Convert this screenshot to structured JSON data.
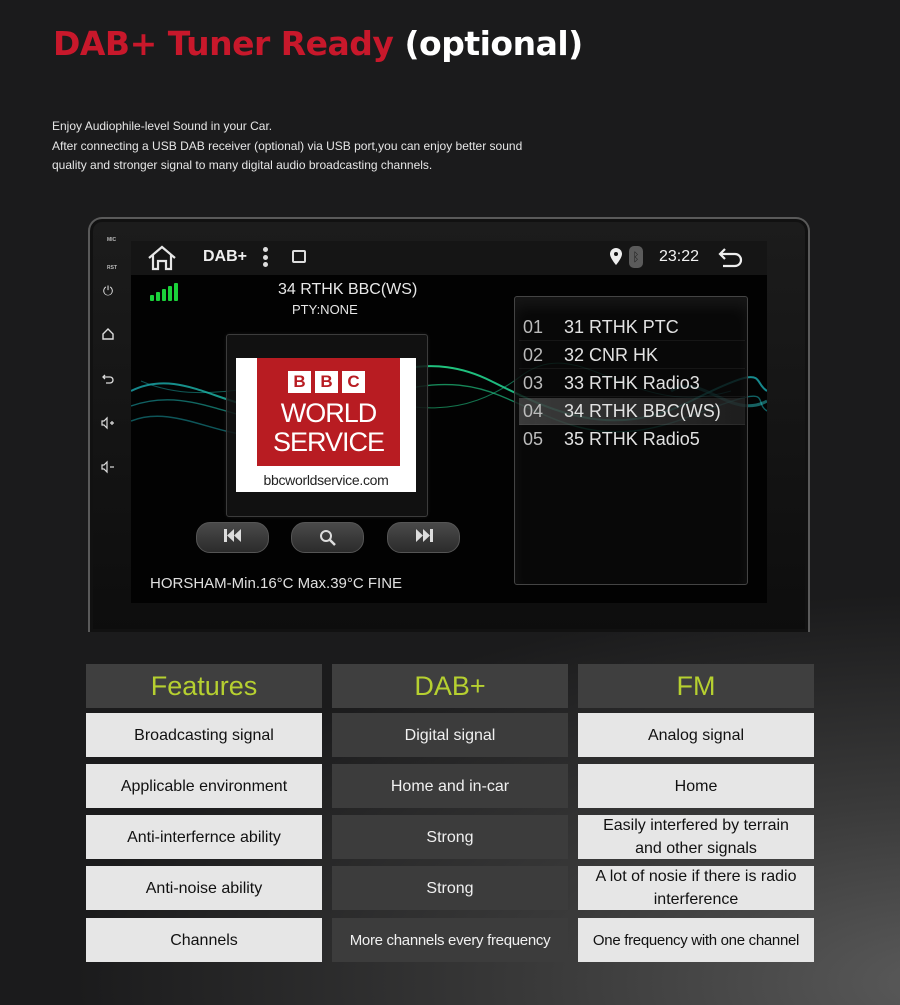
{
  "title": {
    "red": "DAB+ Tuner Ready",
    "white": "(optional)"
  },
  "intro": [
    "Enjoy Audiophile-level Sound in your Car.",
    "After connecting a USB DAB receiver (optional) via USB port,you can enjoy better sound",
    "quality and stronger signal to many digital audio broadcasting channels."
  ],
  "device": {
    "side_labels": {
      "mic": "MIC",
      "rst": "RST"
    },
    "side_icons": [
      "power-icon",
      "home-icon",
      "back-icon",
      "volume-up-icon",
      "volume-down-icon"
    ],
    "topbar": {
      "app": "DAB+",
      "time": "23:22"
    },
    "signal_bars": 5,
    "now_playing": {
      "station": "34 RTHK BBC(WS)",
      "pty": "PTY:NONE"
    },
    "album_art": {
      "line1": "BBC",
      "line2": "WORLD",
      "line3": "SERVICE",
      "url": "bbcworldservice.com"
    },
    "controls": {
      "prev": "⏮",
      "search": "🔍",
      "next": "⏭"
    },
    "weather": "HORSHAM-Min.16°C Max.39°C FINE",
    "stations": [
      {
        "num": "01",
        "name": "31 RTHK PTC",
        "selected": false
      },
      {
        "num": "02",
        "name": "32 CNR HK",
        "selected": false
      },
      {
        "num": "03",
        "name": "33 RTHK Radio3",
        "selected": false
      },
      {
        "num": "04",
        "name": "34 RTHK BBC(WS)",
        "selected": true
      },
      {
        "num": "05",
        "name": "35 RTHK Radio5",
        "selected": false
      }
    ]
  },
  "table": {
    "headers": [
      "Features",
      "DAB+",
      "FM"
    ],
    "rows": [
      [
        "Broadcasting signal",
        "Digital signal",
        "Analog signal"
      ],
      [
        "Applicable environment",
        "Home and in-car",
        "Home"
      ],
      [
        "Anti-interfernce ability",
        "Strong",
        "Easily interfered by terrain and other signals"
      ],
      [
        "Anti-noise ability",
        "Strong",
        "A lot of nosie if there is radio interference"
      ],
      [
        "Channels",
        "More channels every frequency",
        "One frequency with one channel"
      ]
    ]
  },
  "colors": {
    "title_red": "#c8182b",
    "header_green": "#b6d030",
    "signal_green": "#1bd13a",
    "bbc_red": "#b81c22"
  }
}
